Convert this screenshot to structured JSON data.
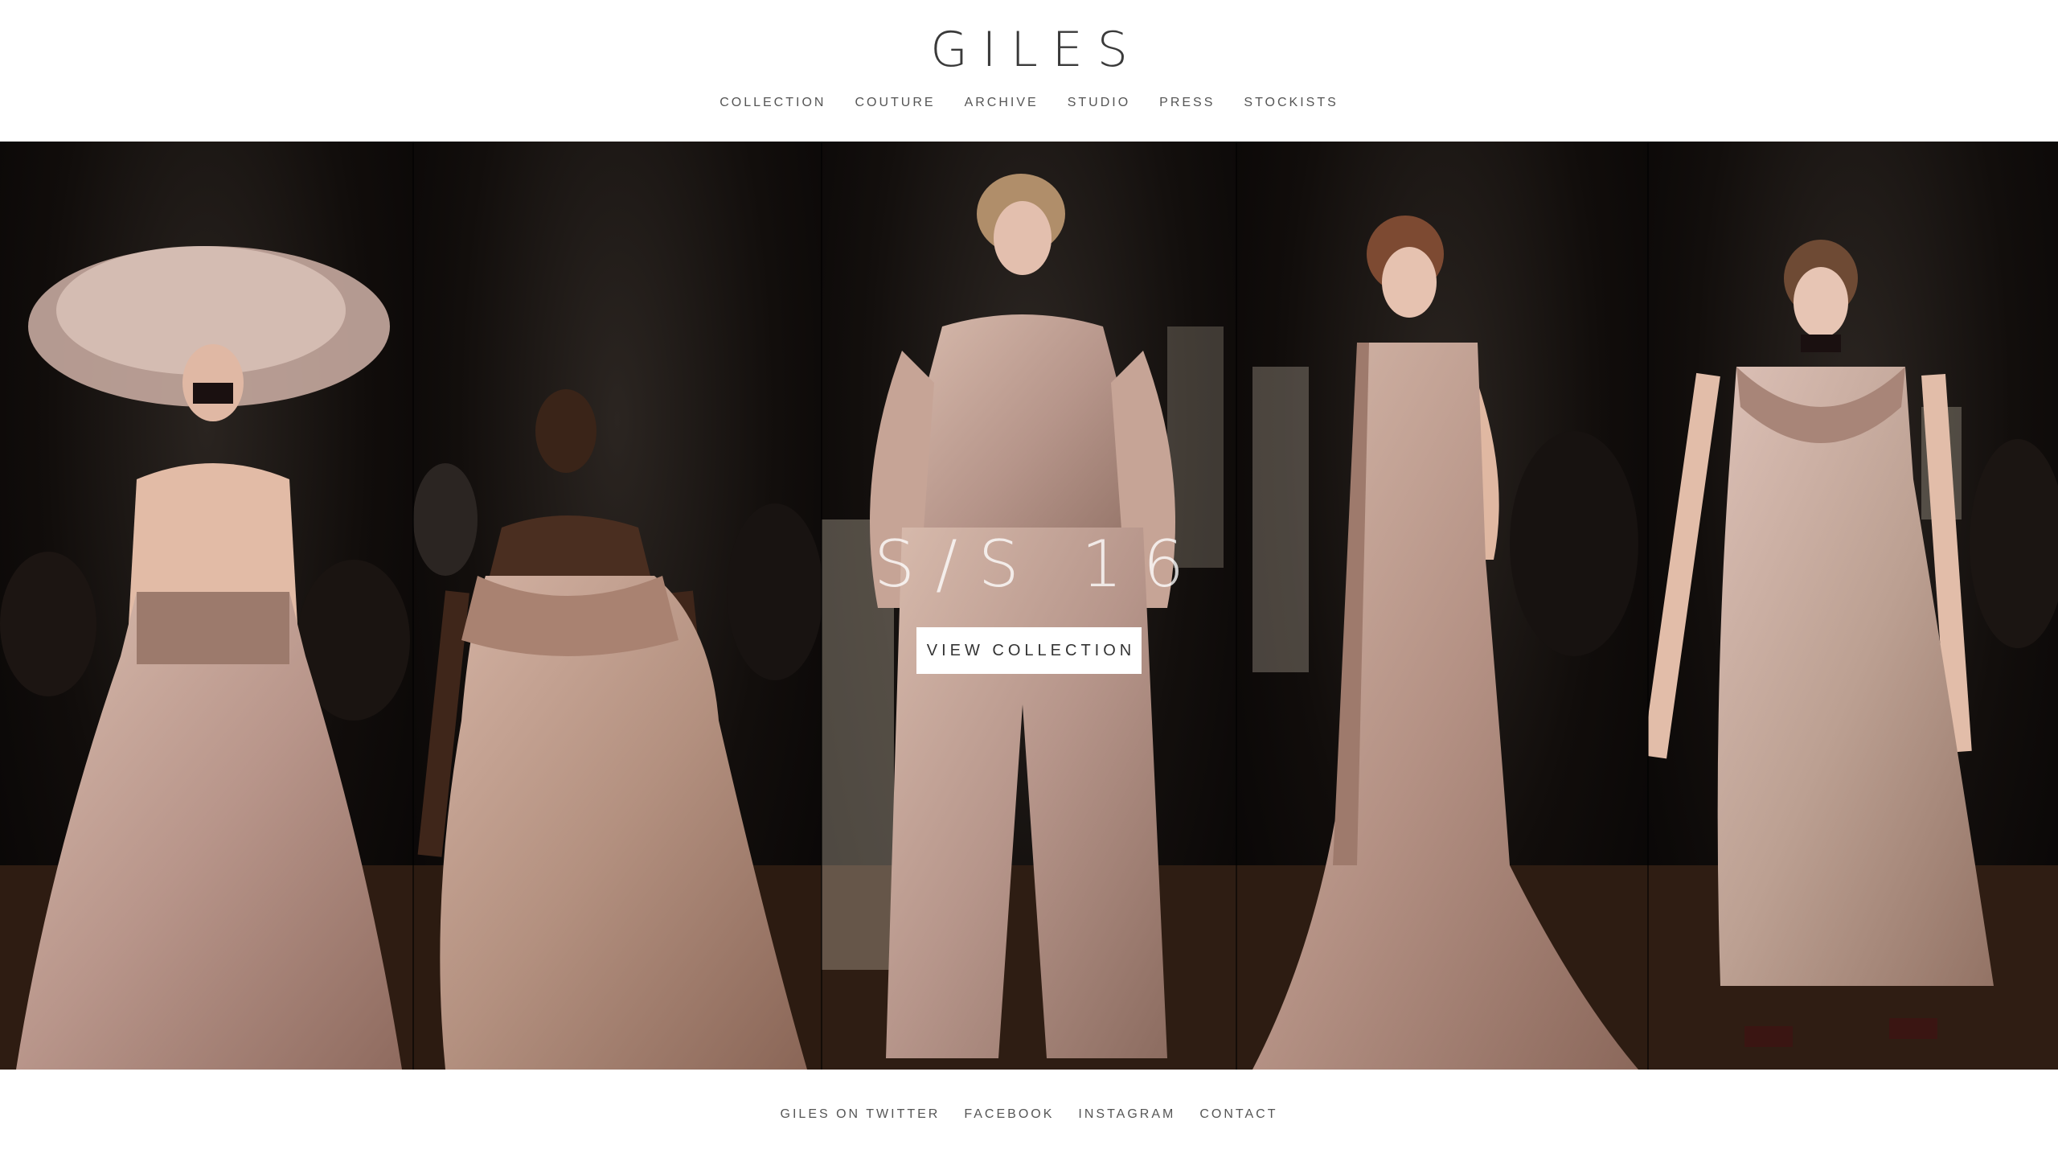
{
  "brand": {
    "logo_text": "GILES"
  },
  "nav": {
    "items": [
      {
        "label": "COLLECTION"
      },
      {
        "label": "COUTURE"
      },
      {
        "label": "ARCHIVE"
      },
      {
        "label": "STUDIO"
      },
      {
        "label": "PRESS"
      },
      {
        "label": "STOCKISTS"
      }
    ]
  },
  "hero": {
    "season_title": "S/S 16",
    "cta_label": "VIEW COLLECTION",
    "looks": [
      {
        "name": "look-1"
      },
      {
        "name": "look-2"
      },
      {
        "name": "look-3"
      },
      {
        "name": "look-4"
      },
      {
        "name": "look-5"
      }
    ]
  },
  "footer": {
    "links": [
      {
        "label": "GILES ON TWITTER"
      },
      {
        "label": "FACEBOOK"
      },
      {
        "label": "INSTAGRAM"
      },
      {
        "label": "CONTACT"
      }
    ]
  },
  "colors": {
    "gown": "#c9a898",
    "gown_dark": "#8a6a5c",
    "runway_bg": "#0a0807",
    "floor": "#3a2418",
    "text": "#333333"
  }
}
